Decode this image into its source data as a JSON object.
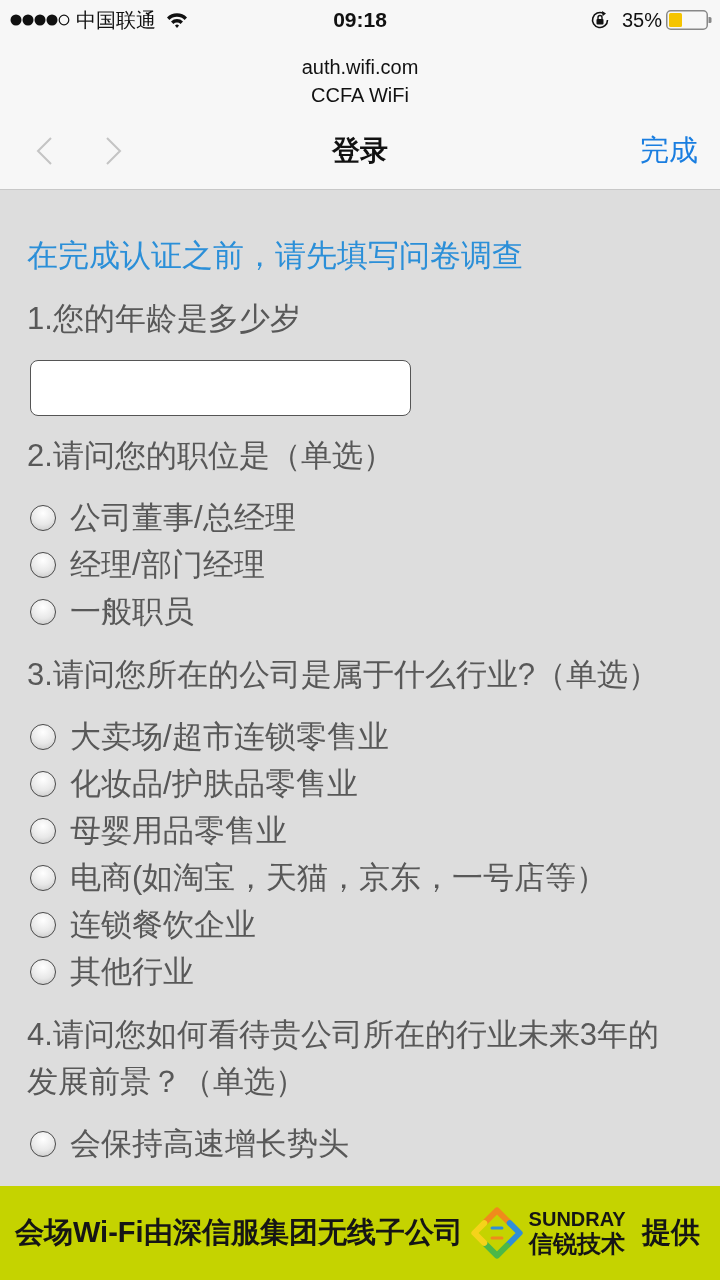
{
  "status_bar": {
    "carrier": "中国联通",
    "time": "09:18",
    "battery": "35%"
  },
  "browser": {
    "url": "auth.wifi.com",
    "site_name": "CCFA WiFi",
    "back": {
      "disabled": true
    },
    "forward": {
      "disabled": true
    },
    "title": "登录",
    "done": "完成"
  },
  "survey": {
    "heading": "在完成认证之前，请先填写问卷调查",
    "questions": [
      {
        "kind": "text",
        "label": "1.您的年龄是多少岁"
      },
      {
        "kind": "choice",
        "label": "2.请问您的职位是（单选）",
        "options": [
          {
            "label": "公司董事/总经理",
            "selected": false
          },
          {
            "label": "经理/部门经理",
            "selected": false
          },
          {
            "label": "一般职员",
            "selected": false
          }
        ]
      },
      {
        "kind": "choice",
        "label": "3.请问您所在的公司是属于什么行业?（单选）",
        "options": [
          {
            "label": "大卖场/超市连锁零售业",
            "selected": false
          },
          {
            "label": "化妆品/护肤品零售业",
            "selected": false
          },
          {
            "label": "母婴用品零售业",
            "selected": false
          },
          {
            "label": "电商(如淘宝，天猫，京东，一号店等）",
            "selected": false
          },
          {
            "label": "连锁餐饮企业",
            "selected": false
          },
          {
            "label": "其他行业",
            "selected": false
          }
        ]
      },
      {
        "kind": "choice",
        "label": "4.请问您如何看待贵公司所在的行业未来3年的发展前景？（单选）",
        "options": [
          {
            "label": "会保持高速增长势头",
            "selected": false
          }
        ]
      }
    ]
  },
  "banner": {
    "text": "会场Wi-Fi由深信服集团无线子公司",
    "brand": "SUNDRAY",
    "brand_cn": "信锐技术",
    "suffix": "提供"
  }
}
